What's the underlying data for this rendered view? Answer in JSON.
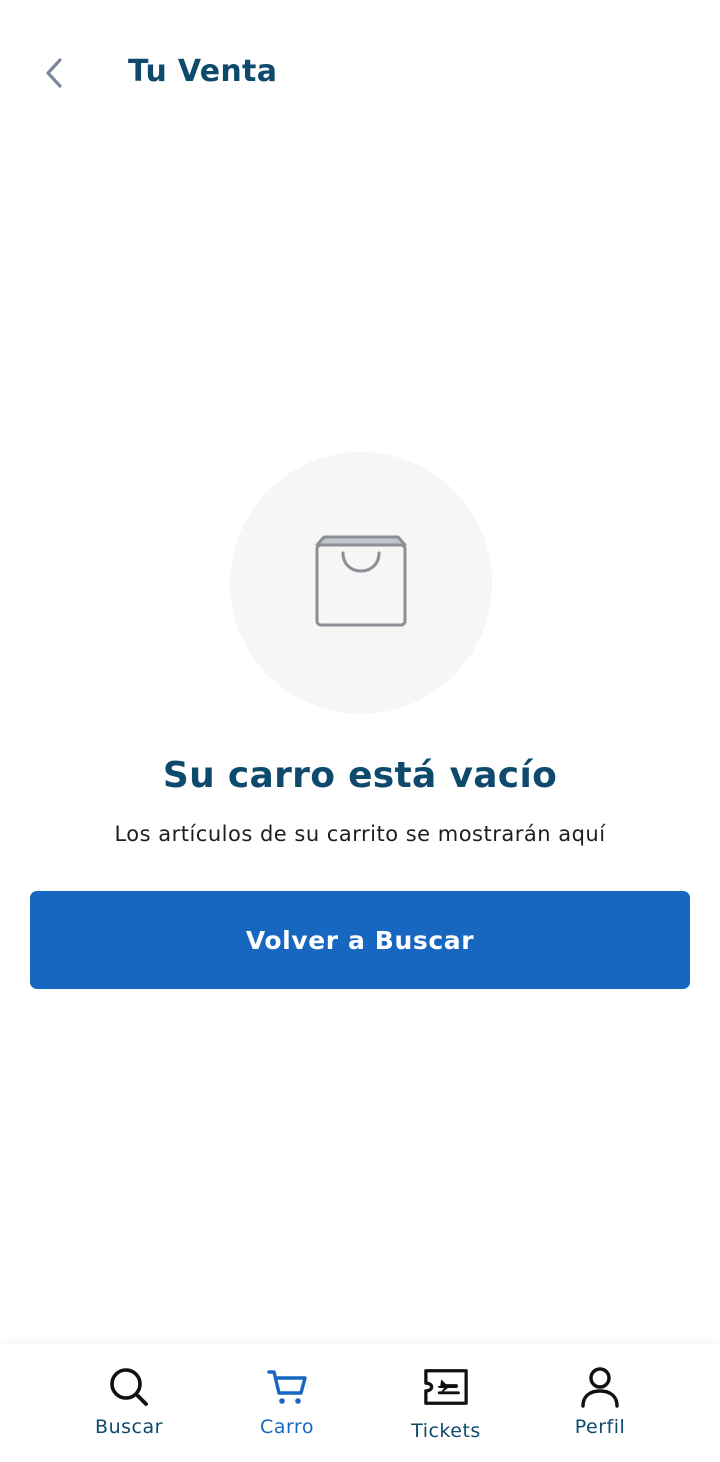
{
  "header": {
    "title": "Tu Venta",
    "back_icon": "chevron-left-icon"
  },
  "empty_state": {
    "icon": "shopping-bag-icon",
    "title": "Su carro está vacío",
    "subtitle": "Los artículos de su carrito se mostrarán aquí",
    "button_label": "Volver a Buscar"
  },
  "bottom_nav": {
    "active": "Carro",
    "items": [
      {
        "label": "Buscar",
        "icon": "search-icon"
      },
      {
        "label": "Carro",
        "icon": "cart-icon"
      },
      {
        "label": "Tickets",
        "icon": "ticket-icon"
      },
      {
        "label": "Perfil",
        "icon": "user-icon"
      }
    ]
  },
  "colors": {
    "primary": "#1767c1",
    "title": "#0e4a6b",
    "icon_gray": "#8d8f96",
    "circle_bg": "#f6f6f7"
  }
}
